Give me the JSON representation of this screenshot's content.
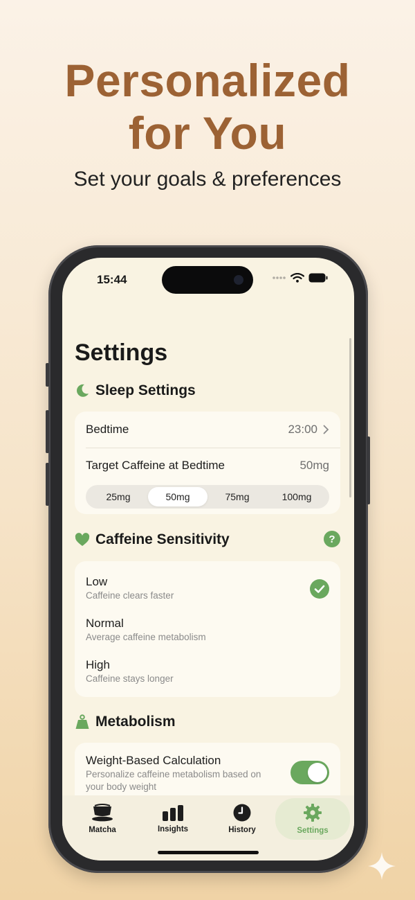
{
  "promo": {
    "headline_line1": "Personalized",
    "headline_line2": "for You",
    "subheadline": "Set your goals & preferences"
  },
  "status_bar": {
    "time": "15:44"
  },
  "page": {
    "title": "Settings"
  },
  "sleep_settings": {
    "heading": "Sleep Settings",
    "bedtime_label": "Bedtime",
    "bedtime_value": "23:00",
    "target_label": "Target Caffeine at Bedtime",
    "target_value": "50mg",
    "options": [
      "25mg",
      "50mg",
      "75mg",
      "100mg"
    ],
    "selected_option": "50mg"
  },
  "caffeine_sensitivity": {
    "heading": "Caffeine Sensitivity",
    "help_icon": "?",
    "options": [
      {
        "title": "Low",
        "description": "Caffeine clears faster",
        "selected": true
      },
      {
        "title": "Normal",
        "description": "Average caffeine metabolism",
        "selected": false
      },
      {
        "title": "High",
        "description": "Caffeine stays longer",
        "selected": false
      }
    ]
  },
  "metabolism": {
    "heading": "Metabolism",
    "weight_title": "Weight-Based Calculation",
    "weight_desc_line1": "Personalize caffeine metabolism based on",
    "weight_desc_line2": "your body weight",
    "weight_enabled": true
  },
  "tab_bar": {
    "tabs": [
      {
        "label": "Matcha",
        "icon": "cup-icon",
        "active": false
      },
      {
        "label": "Insights",
        "icon": "bar-chart-icon",
        "active": false
      },
      {
        "label": "History",
        "icon": "clock-icon",
        "active": false
      },
      {
        "label": "Settings",
        "icon": "gear-icon",
        "active": true
      }
    ]
  },
  "colors": {
    "headline": "#9c6234",
    "accent_green": "#6aa85e",
    "screen_bg": "#f9f3e2",
    "card_bg": "#fdfaf1"
  }
}
